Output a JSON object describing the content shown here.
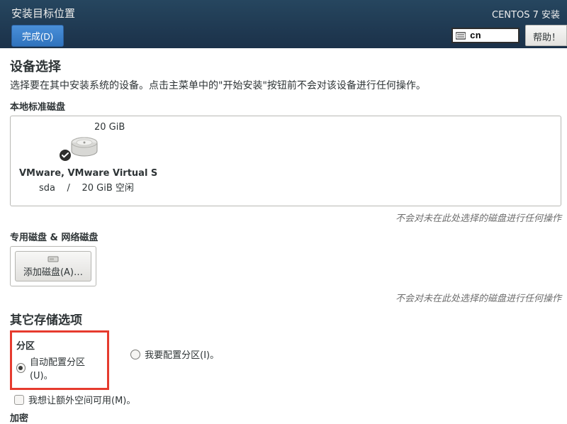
{
  "header": {
    "title": "安装目标位置",
    "done_label": "完成(D)",
    "installer_name": "CENTOS 7 安装",
    "language_code": "cn",
    "help_label": "帮助！"
  },
  "device_selection": {
    "heading": "设备选择",
    "description": "选择要在其中安装系统的设备。点击主菜单中的\"开始安装\"按钮前不会对该设备进行任何操作。",
    "local_disks_heading": "本地标准磁盘",
    "disk": {
      "capacity": "20 GiB",
      "name": "VMware, VMware Virtual S",
      "device": "sda",
      "separator": "/",
      "free": "20 GiB 空闲"
    },
    "hint_unselected": "不会对未在此处选择的磁盘进行任何操作"
  },
  "specialized": {
    "heading": "专用磁盘 & 网络磁盘",
    "add_disk_label": "添加磁盘(A)…",
    "hint": "不会对未在此处选择的磁盘进行任何操作"
  },
  "other_storage": {
    "heading": "其它存储选项",
    "partitioning_heading": "分区",
    "auto_label": "自动配置分区(U)。",
    "manual_label": "我要配置分区(I)。",
    "reclaim_label": "我想让额外空间可用(M)。",
    "encryption_heading": "加密"
  }
}
